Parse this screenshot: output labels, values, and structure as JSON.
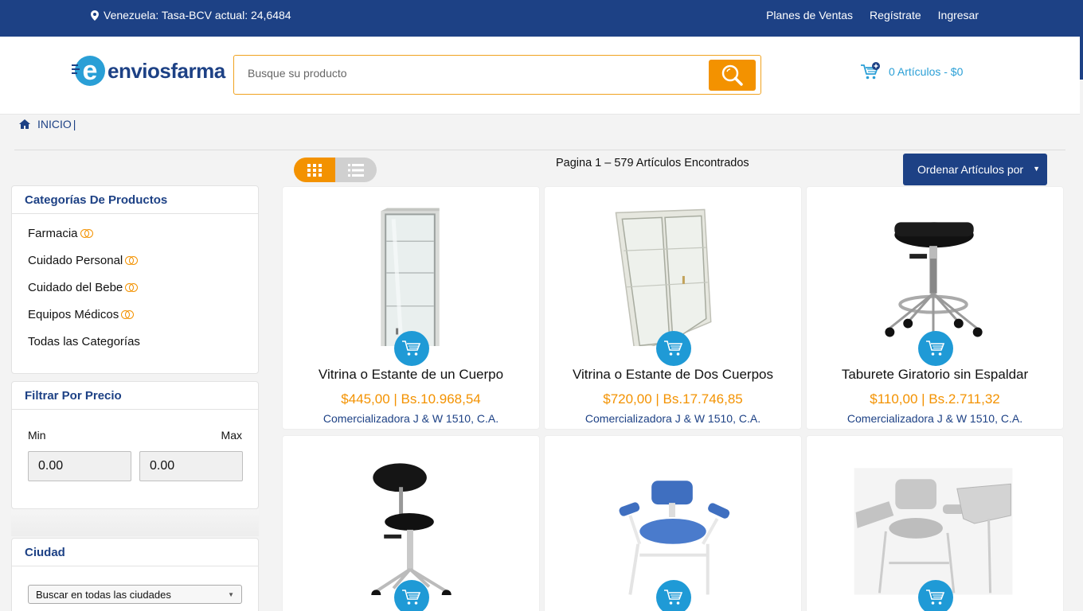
{
  "topbar": {
    "location_text": "Venezuela: Tasa-BCV actual: 24,6484",
    "links": [
      "Planes de Ventas",
      "Regístrate",
      "Ingresar"
    ]
  },
  "header": {
    "logo": {
      "letter": "e",
      "word": "enviosfarma"
    },
    "search_placeholder": "Busque su producto",
    "cart_text": "0 Artículos - $0"
  },
  "breadcrumb": {
    "home": "INICIO",
    "separator": "|"
  },
  "listing": {
    "page_info": "Pagina 1 – 579 Artículos Encontrados",
    "sort_label": "Ordenar Artículos por"
  },
  "sidebar": {
    "categories_title": "Categorías De Productos",
    "categories": [
      "Farmacia",
      "Cuidado Personal",
      "Cuidado del Bebe",
      "Equipos Médicos",
      "Todas las Categorías"
    ],
    "price_title": "Filtrar Por Precio",
    "min_label": "Min",
    "max_label": "Max",
    "min_value": "0.00",
    "max_value": "0.00",
    "city_title": "Ciudad",
    "city_select": "Buscar en todas las ciudades"
  },
  "products": [
    {
      "name": "Vitrina o Estante de un Cuerpo",
      "price": "$445,00 | Bs.10.968,54",
      "vendor": "Comercializadora J & W 1510, C.A.",
      "image": "single-glass-cabinet"
    },
    {
      "name": "Vitrina o Estante de Dos Cuerpos",
      "price": "$720,00 | Bs.17.746,85",
      "vendor": "Comercializadora J & W 1510, C.A.",
      "image": "double-glass-cabinet"
    },
    {
      "name": "Taburete Giratorio sin Espaldar",
      "price": "$110,00 | Bs.2.711,32",
      "vendor": "Comercializadora J & W 1510, C.A.",
      "image": "swivel-stool"
    },
    {
      "name": "",
      "price": "",
      "vendor": "",
      "image": "stool-with-backrest"
    },
    {
      "name": "",
      "price": "",
      "vendor": "",
      "image": "blue-phlebotomy-chair"
    },
    {
      "name": "",
      "price": "",
      "vendor": "",
      "image": "grey-phlebotomy-chair"
    }
  ],
  "colors": {
    "navy": "#1d4185",
    "orange": "#f39200",
    "cyan": "#1f9ad6"
  }
}
